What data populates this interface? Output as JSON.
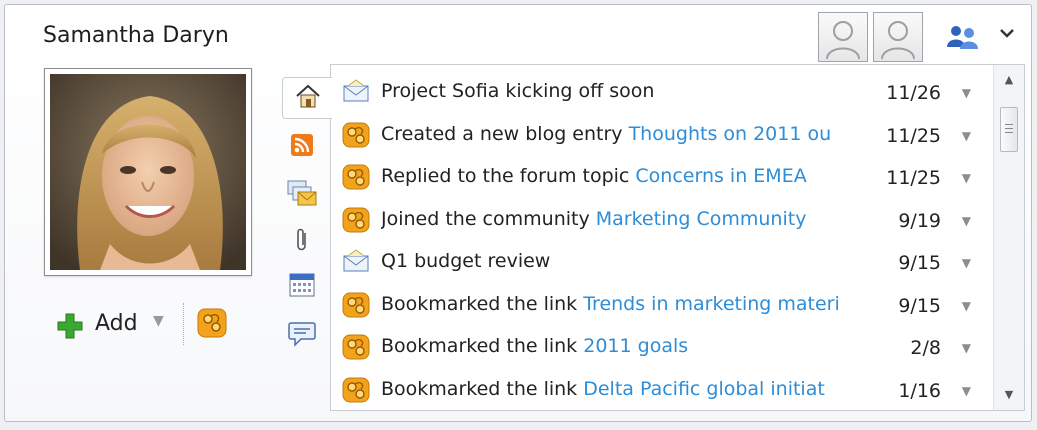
{
  "profile": {
    "name": "Samantha Daryn"
  },
  "header": {
    "contacts_icon": "people-group-icon",
    "menu_icon": "chevron-down-icon"
  },
  "actions": {
    "add_label": "Add"
  },
  "tabs": [
    {
      "icon": "home-icon",
      "active": true
    },
    {
      "icon": "rss-icon",
      "active": false
    },
    {
      "icon": "mail-stack-icon",
      "active": false
    },
    {
      "icon": "attachment-icon",
      "active": false
    },
    {
      "icon": "calendar-icon",
      "active": false
    },
    {
      "icon": "chat-bubble-icon",
      "active": false
    }
  ],
  "feed": [
    {
      "icon": "email-icon",
      "text": "Project Sofia kicking off soon",
      "link": "",
      "date": "11/26"
    },
    {
      "icon": "activity-icon",
      "text": "Created a new blog entry ",
      "link": "Thoughts on 2011 ou",
      "date": "11/25"
    },
    {
      "icon": "activity-icon",
      "text": "Replied to the forum topic ",
      "link": "Concerns in EMEA",
      "date": "11/25"
    },
    {
      "icon": "activity-icon",
      "text": "Joined the community ",
      "link": "Marketing Community",
      "date": "9/19"
    },
    {
      "icon": "email-icon",
      "text": "Q1 budget review",
      "link": "",
      "date": "9/15"
    },
    {
      "icon": "activity-icon",
      "text": "Bookmarked the link ",
      "link": "Trends in marketing materi",
      "date": "9/15"
    },
    {
      "icon": "activity-icon",
      "text": "Bookmarked the link ",
      "link": "2011 goals",
      "date": "2/8"
    },
    {
      "icon": "activity-icon",
      "text": "Bookmarked the link ",
      "link": "Delta Pacific global initiat",
      "date": "1/16"
    }
  ],
  "colors": {
    "link": "#2d8dd8",
    "activity_orange": "#f2a31b",
    "add_green": "#3aa832"
  }
}
